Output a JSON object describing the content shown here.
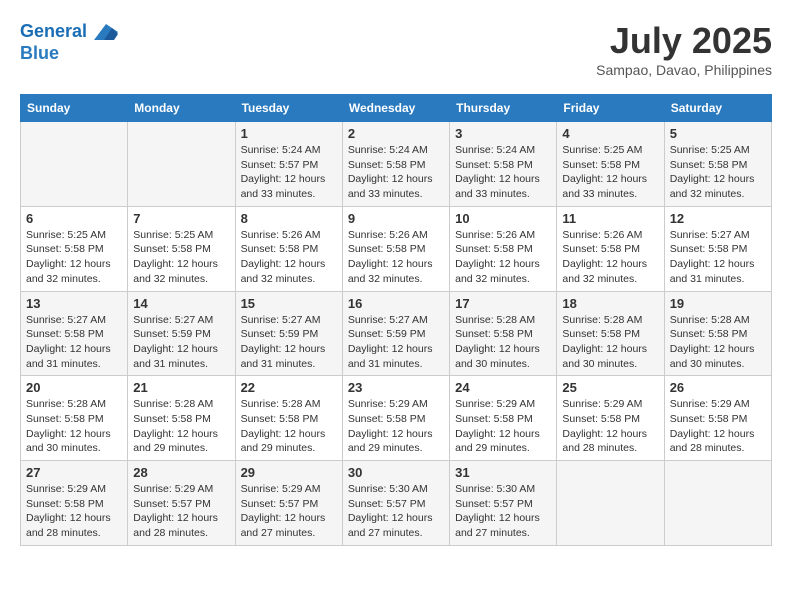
{
  "header": {
    "logo_line1": "General",
    "logo_line2": "Blue",
    "month_year": "July 2025",
    "location": "Sampao, Davao, Philippines"
  },
  "weekdays": [
    "Sunday",
    "Monday",
    "Tuesday",
    "Wednesday",
    "Thursday",
    "Friday",
    "Saturday"
  ],
  "weeks": [
    [
      {
        "day": "",
        "info": ""
      },
      {
        "day": "",
        "info": ""
      },
      {
        "day": "1",
        "info": "Sunrise: 5:24 AM\nSunset: 5:57 PM\nDaylight: 12 hours\nand 33 minutes."
      },
      {
        "day": "2",
        "info": "Sunrise: 5:24 AM\nSunset: 5:58 PM\nDaylight: 12 hours\nand 33 minutes."
      },
      {
        "day": "3",
        "info": "Sunrise: 5:24 AM\nSunset: 5:58 PM\nDaylight: 12 hours\nand 33 minutes."
      },
      {
        "day": "4",
        "info": "Sunrise: 5:25 AM\nSunset: 5:58 PM\nDaylight: 12 hours\nand 33 minutes."
      },
      {
        "day": "5",
        "info": "Sunrise: 5:25 AM\nSunset: 5:58 PM\nDaylight: 12 hours\nand 32 minutes."
      }
    ],
    [
      {
        "day": "6",
        "info": "Sunrise: 5:25 AM\nSunset: 5:58 PM\nDaylight: 12 hours\nand 32 minutes."
      },
      {
        "day": "7",
        "info": "Sunrise: 5:25 AM\nSunset: 5:58 PM\nDaylight: 12 hours\nand 32 minutes."
      },
      {
        "day": "8",
        "info": "Sunrise: 5:26 AM\nSunset: 5:58 PM\nDaylight: 12 hours\nand 32 minutes."
      },
      {
        "day": "9",
        "info": "Sunrise: 5:26 AM\nSunset: 5:58 PM\nDaylight: 12 hours\nand 32 minutes."
      },
      {
        "day": "10",
        "info": "Sunrise: 5:26 AM\nSunset: 5:58 PM\nDaylight: 12 hours\nand 32 minutes."
      },
      {
        "day": "11",
        "info": "Sunrise: 5:26 AM\nSunset: 5:58 PM\nDaylight: 12 hours\nand 32 minutes."
      },
      {
        "day": "12",
        "info": "Sunrise: 5:27 AM\nSunset: 5:58 PM\nDaylight: 12 hours\nand 31 minutes."
      }
    ],
    [
      {
        "day": "13",
        "info": "Sunrise: 5:27 AM\nSunset: 5:58 PM\nDaylight: 12 hours\nand 31 minutes."
      },
      {
        "day": "14",
        "info": "Sunrise: 5:27 AM\nSunset: 5:59 PM\nDaylight: 12 hours\nand 31 minutes."
      },
      {
        "day": "15",
        "info": "Sunrise: 5:27 AM\nSunset: 5:59 PM\nDaylight: 12 hours\nand 31 minutes."
      },
      {
        "day": "16",
        "info": "Sunrise: 5:27 AM\nSunset: 5:59 PM\nDaylight: 12 hours\nand 31 minutes."
      },
      {
        "day": "17",
        "info": "Sunrise: 5:28 AM\nSunset: 5:58 PM\nDaylight: 12 hours\nand 30 minutes."
      },
      {
        "day": "18",
        "info": "Sunrise: 5:28 AM\nSunset: 5:58 PM\nDaylight: 12 hours\nand 30 minutes."
      },
      {
        "day": "19",
        "info": "Sunrise: 5:28 AM\nSunset: 5:58 PM\nDaylight: 12 hours\nand 30 minutes."
      }
    ],
    [
      {
        "day": "20",
        "info": "Sunrise: 5:28 AM\nSunset: 5:58 PM\nDaylight: 12 hours\nand 30 minutes."
      },
      {
        "day": "21",
        "info": "Sunrise: 5:28 AM\nSunset: 5:58 PM\nDaylight: 12 hours\nand 29 minutes."
      },
      {
        "day": "22",
        "info": "Sunrise: 5:28 AM\nSunset: 5:58 PM\nDaylight: 12 hours\nand 29 minutes."
      },
      {
        "day": "23",
        "info": "Sunrise: 5:29 AM\nSunset: 5:58 PM\nDaylight: 12 hours\nand 29 minutes."
      },
      {
        "day": "24",
        "info": "Sunrise: 5:29 AM\nSunset: 5:58 PM\nDaylight: 12 hours\nand 29 minutes."
      },
      {
        "day": "25",
        "info": "Sunrise: 5:29 AM\nSunset: 5:58 PM\nDaylight: 12 hours\nand 28 minutes."
      },
      {
        "day": "26",
        "info": "Sunrise: 5:29 AM\nSunset: 5:58 PM\nDaylight: 12 hours\nand 28 minutes."
      }
    ],
    [
      {
        "day": "27",
        "info": "Sunrise: 5:29 AM\nSunset: 5:58 PM\nDaylight: 12 hours\nand 28 minutes."
      },
      {
        "day": "28",
        "info": "Sunrise: 5:29 AM\nSunset: 5:57 PM\nDaylight: 12 hours\nand 28 minutes."
      },
      {
        "day": "29",
        "info": "Sunrise: 5:29 AM\nSunset: 5:57 PM\nDaylight: 12 hours\nand 27 minutes."
      },
      {
        "day": "30",
        "info": "Sunrise: 5:30 AM\nSunset: 5:57 PM\nDaylight: 12 hours\nand 27 minutes."
      },
      {
        "day": "31",
        "info": "Sunrise: 5:30 AM\nSunset: 5:57 PM\nDaylight: 12 hours\nand 27 minutes."
      },
      {
        "day": "",
        "info": ""
      },
      {
        "day": "",
        "info": ""
      }
    ]
  ]
}
